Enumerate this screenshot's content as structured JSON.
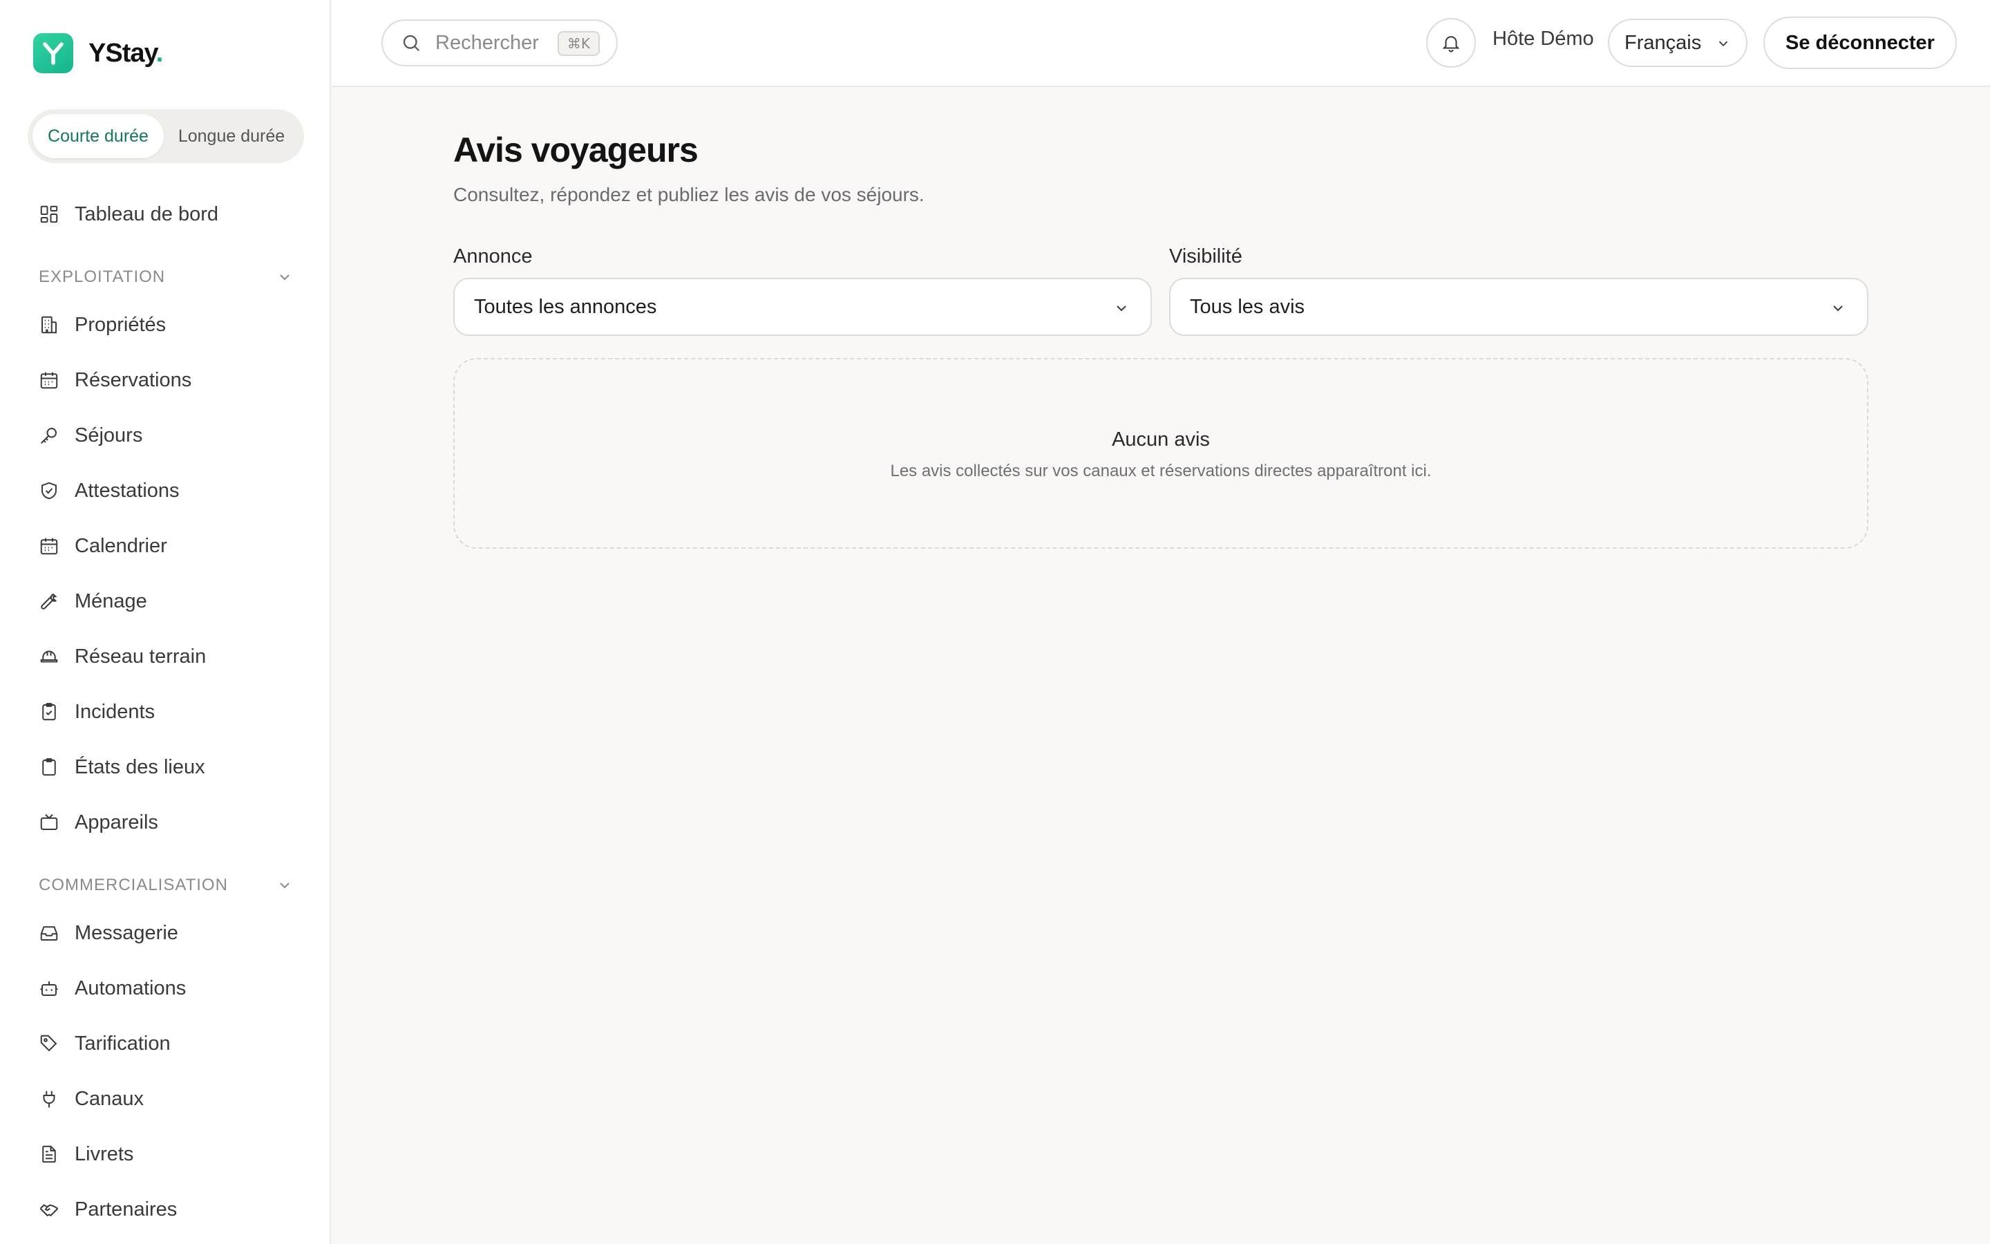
{
  "brand": {
    "name": "YStay",
    "dot": ".",
    "accent": "#15b184"
  },
  "mode": {
    "active": "Courte durée",
    "inactive": "Longue durée"
  },
  "sidebar": {
    "dashboard": "Tableau de bord",
    "sections": [
      {
        "title": "EXPLOITATION",
        "items": [
          "Propriétés",
          "Réservations",
          "Séjours",
          "Attestations",
          "Calendrier",
          "Ménage",
          "Réseau terrain",
          "Incidents",
          "États des lieux",
          "Appareils"
        ]
      },
      {
        "title": "COMMERCIALISATION",
        "items": [
          "Messagerie",
          "Automations",
          "Tarification",
          "Canaux",
          "Livrets",
          "Partenaires"
        ]
      }
    ]
  },
  "topbar": {
    "search_placeholder": "Rechercher",
    "search_shortcut": "⌘K",
    "user": "Hôte Démo",
    "language": "Français",
    "logout": "Se déconnecter"
  },
  "main": {
    "title": "Avis voyageurs",
    "subtitle": "Consultez, répondez et publiez les avis de vos séjours.",
    "filters": {
      "listing_label": "Annonce",
      "listing_value": "Toutes les annonces",
      "visibility_label": "Visibilité",
      "visibility_value": "Tous les avis"
    },
    "empty": {
      "title": "Aucun avis",
      "description": "Les avis collectés sur vos canaux et réservations directes apparaîtront ici."
    }
  }
}
